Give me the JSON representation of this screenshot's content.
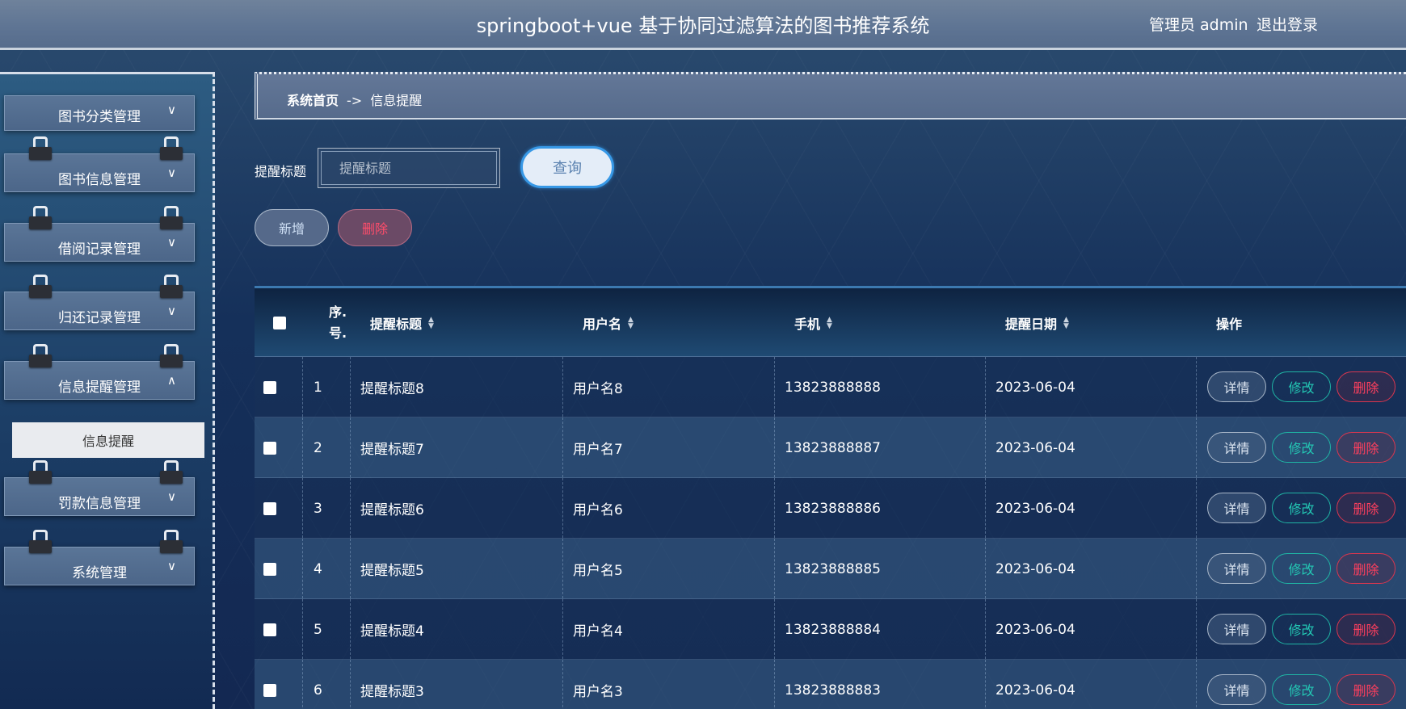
{
  "header": {
    "title": "springboot+vue 基于协同过滤算法的图书推荐系统",
    "user": "管理员 admin",
    "logout": "退出登录"
  },
  "sidebar": {
    "menus": [
      {
        "label": "图书分类管理",
        "chevron": "∨"
      },
      {
        "label": "图书信息管理",
        "chevron": "∨"
      },
      {
        "label": "借阅记录管理",
        "chevron": "∨"
      },
      {
        "label": "归还记录管理",
        "chevron": "∨"
      },
      {
        "label": "信息提醒管理",
        "chevron": "∧"
      },
      {
        "label": "罚款信息管理",
        "chevron": "∨"
      },
      {
        "label": "系统管理",
        "chevron": "∨"
      }
    ],
    "submenu": {
      "label": "信息提醒"
    }
  },
  "breadcrumb": {
    "home": "系统首页",
    "sep": "->",
    "current": "信息提醒"
  },
  "search": {
    "label": "提醒标题",
    "placeholder": "提醒标题",
    "query": "查询"
  },
  "actions": {
    "add": "新增",
    "delete": "删除"
  },
  "table": {
    "headers": {
      "index_line1": "序.",
      "index_line2": "号.",
      "title": "提醒标题",
      "username": "用户名",
      "phone": "手机",
      "date": "提醒日期",
      "ops": "操作"
    },
    "op_labels": {
      "detail": "详情",
      "edit": "修改",
      "delete": "删除"
    },
    "rows": [
      {
        "no": "1",
        "title": "提醒标题8",
        "username": "用户名8",
        "phone": "13823888888",
        "date": "2023-06-04"
      },
      {
        "no": "2",
        "title": "提醒标题7",
        "username": "用户名7",
        "phone": "13823888887",
        "date": "2023-06-04"
      },
      {
        "no": "3",
        "title": "提醒标题6",
        "username": "用户名6",
        "phone": "13823888886",
        "date": "2023-06-04"
      },
      {
        "no": "4",
        "title": "提醒标题5",
        "username": "用户名5",
        "phone": "13823888885",
        "date": "2023-06-04"
      },
      {
        "no": "5",
        "title": "提醒标题4",
        "username": "用户名4",
        "phone": "13823888884",
        "date": "2023-06-04"
      },
      {
        "no": "6",
        "title": "提醒标题3",
        "username": "用户名3",
        "phone": "13823888883",
        "date": "2023-06-04"
      }
    ]
  }
}
